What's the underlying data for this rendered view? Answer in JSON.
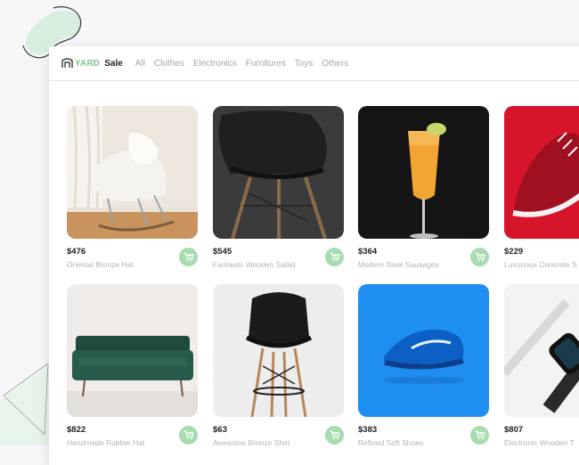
{
  "brand": {
    "yard": "YARD",
    "sale": "Sale"
  },
  "nav": [
    "All",
    "Clothes",
    "Electronics",
    "Furnitures",
    "Toys",
    "Others"
  ],
  "products": [
    {
      "price": "$476",
      "name": "Oriental Bronze Hat",
      "image": "white-rocking-chair"
    },
    {
      "price": "$545",
      "name": "Fantastic Wooden Salad",
      "image": "black-chair"
    },
    {
      "price": "$364",
      "name": "Modern Steel Sausages",
      "image": "orange-cocktail"
    },
    {
      "price": "$229",
      "name": "Luxurious Concrete S",
      "image": "red-sneaker"
    },
    {
      "price": "$822",
      "name": "Handmade Rubber Hat",
      "image": "green-sofa"
    },
    {
      "price": "$63",
      "name": "Awesome Bronze Shirt",
      "image": "bar-stool"
    },
    {
      "price": "$383",
      "name": "Refined Soft Shoes",
      "image": "blue-sneaker"
    },
    {
      "price": "$807",
      "name": "Electronic Wooden T",
      "image": "smartwatch"
    }
  ],
  "colors": {
    "accent": "#7ac88a",
    "cart_bg": "#a6dcae"
  }
}
